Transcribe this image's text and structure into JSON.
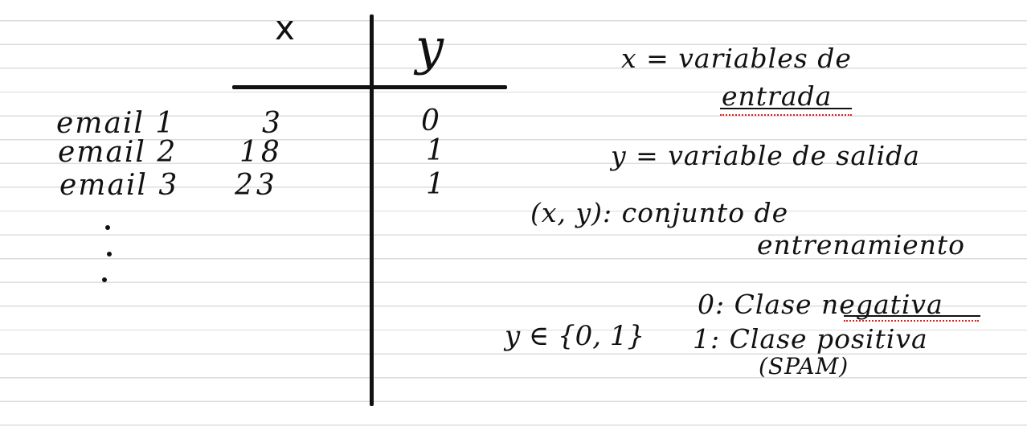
{
  "table": {
    "col_x": "x",
    "col_y": "y",
    "rows": [
      {
        "label": "email 1",
        "x": "3",
        "y": "0"
      },
      {
        "label": "email 2",
        "x": "18",
        "y": "1"
      },
      {
        "label": "email 3",
        "x": "23",
        "y": "1"
      }
    ],
    "ellipsis": "⋮"
  },
  "notes": {
    "x_def_1": "x = variables de",
    "x_def_2": "entrada",
    "y_def": "y = variable de salida",
    "xy_def_1": "(x, y): conjunto de",
    "xy_def_2": "entrenamiento",
    "y_set": "y ∈ {0, 1}",
    "class_0": "0: Clase negativa",
    "class_1": "1: Clase positiva",
    "class_1_note": "(SPAM)"
  },
  "colors": {
    "ink": "#111111",
    "spellcheck": "#e02020",
    "ruled_line": "#dcdcdc"
  }
}
